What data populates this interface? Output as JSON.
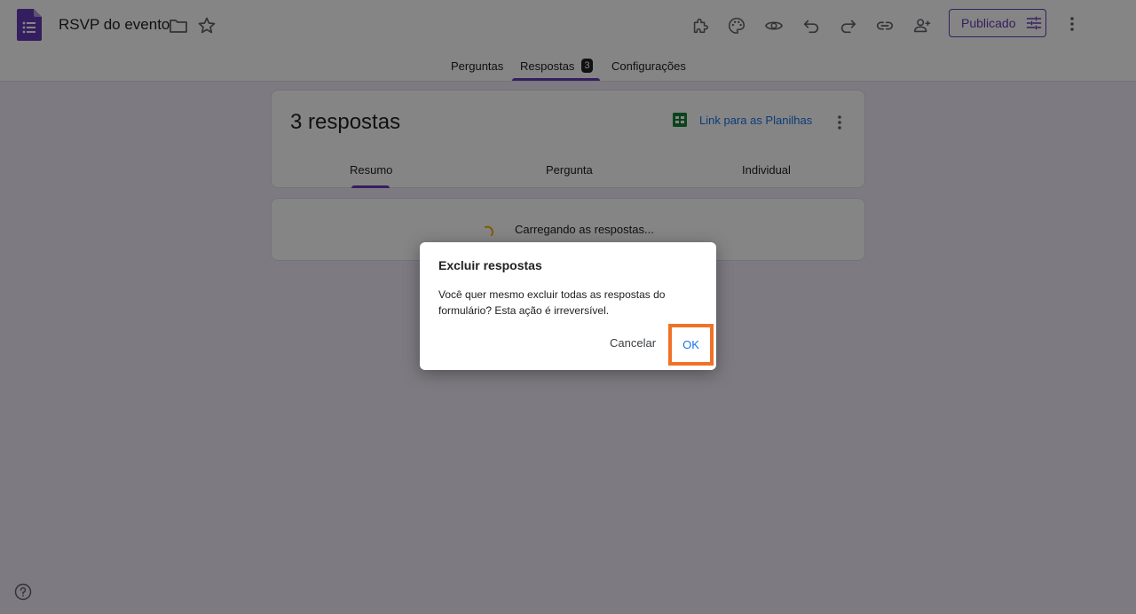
{
  "header": {
    "title": "RSVP do evento",
    "publish_label": "Publicado"
  },
  "tabs": {
    "questions": "Perguntas",
    "responses": "Respostas",
    "responses_badge": "3",
    "settings": "Configurações"
  },
  "summary": {
    "count_text": "3 respostas",
    "sheets_link": "Link para as Planilhas",
    "subtabs": {
      "summary": "Resumo",
      "question": "Pergunta",
      "individual": "Individual"
    }
  },
  "loading": {
    "text": "Carregando as respostas..."
  },
  "dialog": {
    "title": "Excluir respostas",
    "body": "Você quer mesmo excluir todas as respostas do formulário? Esta ação é irreversível.",
    "cancel": "Cancelar",
    "ok": "OK"
  },
  "colors": {
    "accent": "#673ab7",
    "link": "#1a73e8",
    "highlight": "#f07228",
    "sheets_green": "#188038"
  },
  "icons": [
    "forms-logo-icon",
    "folder-icon",
    "star-icon",
    "addon-icon",
    "palette-icon",
    "preview-icon",
    "undo-icon",
    "redo-icon",
    "link-icon",
    "add-collaborator-icon",
    "tune-icon",
    "more-vert-icon",
    "sheets-icon",
    "spinner-icon",
    "help-icon"
  ]
}
